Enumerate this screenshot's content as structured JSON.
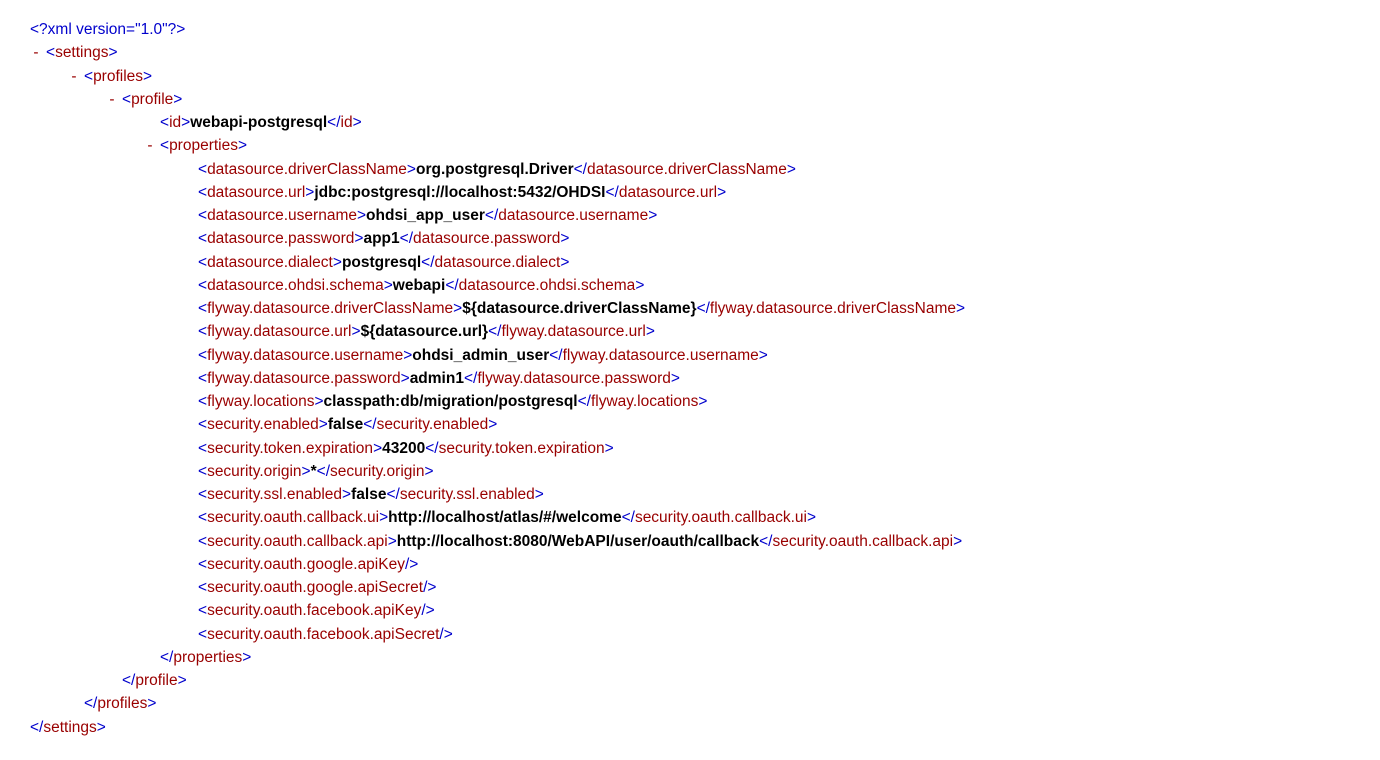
{
  "toggle": "-",
  "xmlDecl": "<?xml version=\"1.0\"?>",
  "root": "settings",
  "profiles": "profiles",
  "profile": "profile",
  "id": {
    "tag": "id",
    "val": "webapi-postgresql"
  },
  "properties": "properties",
  "props": [
    {
      "tag": "datasource.driverClassName",
      "val": "org.postgresql.Driver"
    },
    {
      "tag": "datasource.url",
      "val": "jdbc:postgresql://localhost:5432/OHDSI"
    },
    {
      "tag": "datasource.username",
      "val": "ohdsi_app_user"
    },
    {
      "tag": "datasource.password",
      "val": "app1"
    },
    {
      "tag": "datasource.dialect",
      "val": "postgresql"
    },
    {
      "tag": "datasource.ohdsi.schema",
      "val": "webapi"
    },
    {
      "tag": "flyway.datasource.driverClassName",
      "val": "${datasource.driverClassName}"
    },
    {
      "tag": "flyway.datasource.url",
      "val": "${datasource.url}"
    },
    {
      "tag": "flyway.datasource.username",
      "val": "ohdsi_admin_user"
    },
    {
      "tag": "flyway.datasource.password",
      "val": "admin1"
    },
    {
      "tag": "flyway.locations",
      "val": "classpath:db/migration/postgresql"
    },
    {
      "tag": "security.enabled",
      "val": "false"
    },
    {
      "tag": "security.token.expiration",
      "val": "43200"
    },
    {
      "tag": "security.origin",
      "val": "*"
    },
    {
      "tag": "security.ssl.enabled",
      "val": "false"
    },
    {
      "tag": "security.oauth.callback.ui",
      "val": "http://localhost/atlas/#/welcome"
    },
    {
      "tag": "security.oauth.callback.api",
      "val": "http://localhost:8080/WebAPI/user/oauth/callback"
    }
  ],
  "emptyProps": [
    "security.oauth.google.apiKey",
    "security.oauth.google.apiSecret",
    "security.oauth.facebook.apiKey",
    "security.oauth.facebook.apiSecret"
  ]
}
